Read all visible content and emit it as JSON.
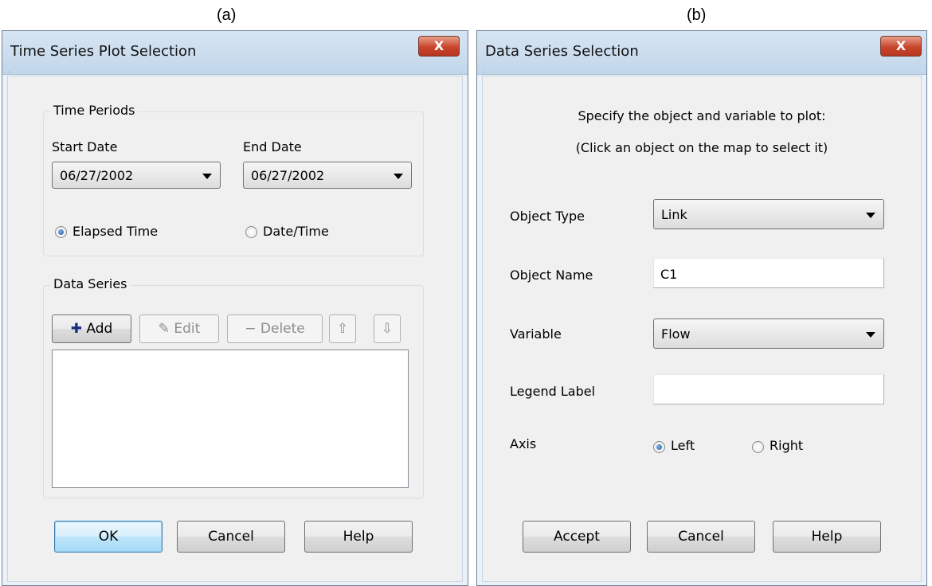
{
  "captions": {
    "a": "(a)",
    "b": "(b)"
  },
  "dialog_a": {
    "title": "Time Series Plot Selection",
    "close_label": "X",
    "time_periods": {
      "legend": "Time Periods",
      "start_label": "Start Date",
      "start_value": "06/27/2002",
      "end_label": "End Date",
      "end_value": "06/27/2002",
      "radio_elapsed": "Elapsed Time",
      "radio_datetime": "Date/Time",
      "selected": "Elapsed Time"
    },
    "data_series": {
      "legend": "Data Series",
      "add_icon": "plus-icon",
      "add_label": "Add",
      "edit_icon": "edit-pencil-icon",
      "edit_label": "Edit",
      "delete_icon": "minus-icon",
      "delete_label": "Delete",
      "up_icon": "arrow-up-icon",
      "down_icon": "arrow-down-icon",
      "items": []
    },
    "buttons": {
      "ok": "OK",
      "cancel": "Cancel",
      "help": "Help"
    }
  },
  "dialog_b": {
    "title": "Data Series Selection",
    "close_label": "X",
    "instruction_1": "Specify the object and variable to plot:",
    "instruction_2": "(Click an object on the map to select it)",
    "object_type_label": "Object Type",
    "object_type_value": "Link",
    "object_name_label": "Object Name",
    "object_name_value": "C1",
    "variable_label": "Variable",
    "variable_value": "Flow",
    "legend_label_label": "Legend Label",
    "legend_label_value": "",
    "axis_label": "Axis",
    "axis_left": "Left",
    "axis_right": "Right",
    "axis_selected": "Left",
    "buttons": {
      "accept": "Accept",
      "cancel": "Cancel",
      "help": "Help"
    }
  },
  "colors": {
    "frame": "#c2d6ea",
    "client": "#f0f0f0",
    "close": "#c9452c",
    "radio_dot": "#1d5aa7",
    "default_button": "#bee6fd"
  }
}
